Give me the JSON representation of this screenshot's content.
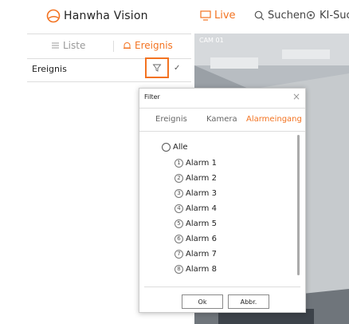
{
  "header": {
    "brand": "Hanwha Vision",
    "nav": [
      {
        "label": "Live",
        "icon": "monitor-icon",
        "active": true
      },
      {
        "label": "Suchen",
        "icon": "search-icon",
        "active": false
      },
      {
        "label": "KI-Suc",
        "icon": "ai-search-icon",
        "active": false
      }
    ]
  },
  "sidebar": {
    "tabs": [
      {
        "label": "Liste",
        "icon": "list-icon"
      },
      {
        "label": "Ereignis",
        "icon": "bell-icon",
        "active": true
      }
    ],
    "event_label": "Ereignis"
  },
  "camera": {
    "label": "CAM 01"
  },
  "filter": {
    "title": "Filter",
    "tabs": [
      "Ereignis",
      "Kamera",
      "Alarmeingang"
    ],
    "active_tab": "Alarmeingang",
    "all_label": "Alle",
    "items": [
      {
        "num": "1",
        "label": "Alarm 1"
      },
      {
        "num": "2",
        "label": "Alarm 2"
      },
      {
        "num": "3",
        "label": "Alarm 3"
      },
      {
        "num": "4",
        "label": "Alarm 4"
      },
      {
        "num": "5",
        "label": "Alarm 5"
      },
      {
        "num": "6",
        "label": "Alarm 6"
      },
      {
        "num": "7",
        "label": "Alarm 7"
      },
      {
        "num": "8",
        "label": "Alarm 8"
      }
    ],
    "ok_label": "Ok",
    "cancel_label": "Abbr."
  },
  "colors": {
    "accent": "#f37321"
  }
}
